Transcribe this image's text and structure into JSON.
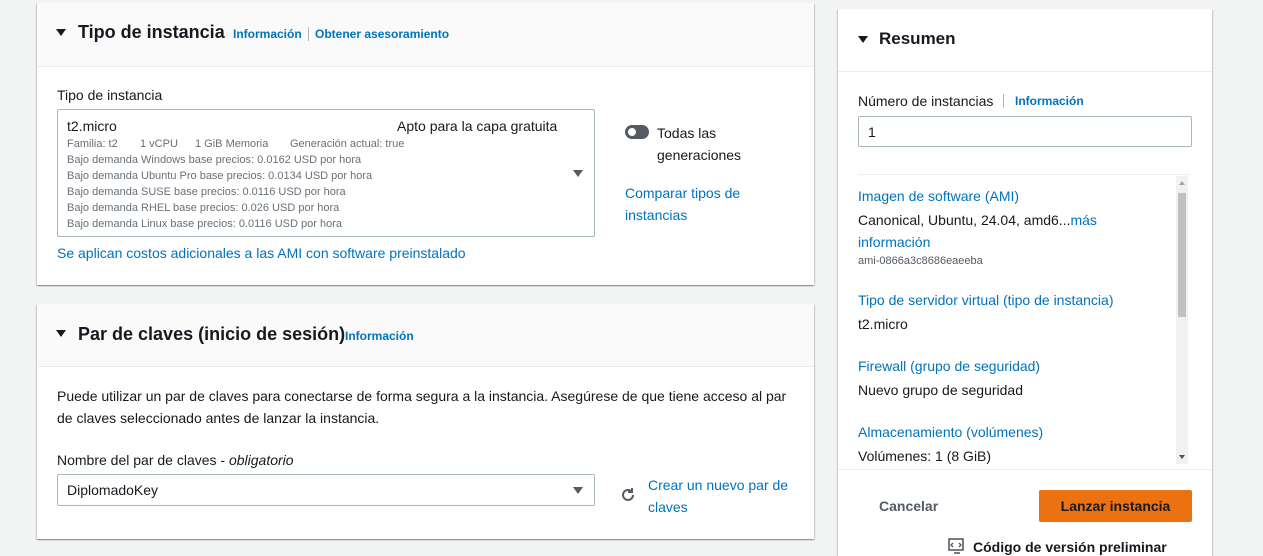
{
  "instance_type": {
    "title": "Tipo de instancia",
    "info_link": "Información",
    "advice_link": "Obtener asesoramiento",
    "field_label": "Tipo de instancia",
    "selected": {
      "name": "t2.micro",
      "free_tier": "Apto para la capa gratuita",
      "family": "Familia: t2",
      "vcpu": "1 vCPU",
      "memory": "1 GiB Memoria",
      "generation": "Generación actual: true",
      "prices": [
        "Bajo demanda Windows base precios: 0.0162 USD por hora",
        "Bajo demanda Ubuntu Pro base precios: 0.0134 USD por hora",
        "Bajo demanda SUSE base precios: 0.0116 USD por hora",
        "Bajo demanda RHEL base precios: 0.026 USD por hora",
        "Bajo demanda Linux base precios: 0.0116 USD por hora"
      ]
    },
    "toggle_label_1": "Todas las",
    "toggle_label_2": "generaciones",
    "compare_link_1": "Comparar tipos de",
    "compare_link_2": "instancias",
    "costs_note": "Se aplican costos adicionales a las AMI con software preinstalado"
  },
  "key_pair": {
    "title": "Par de claves (inicio de sesión)",
    "info_link": "Información",
    "desc_1": "Puede utilizar un par de claves para conectarse de forma segura a la instancia. Asegúrese de que tiene acceso al par",
    "desc_2": "de claves seleccionado antes de lanzar la instancia.",
    "field_label": "Nombre del par de claves - ",
    "field_required": "obligatorio",
    "selected": "DiplomadoKey",
    "create_link_1": "Crear un nuevo par de",
    "create_link_2": "claves"
  },
  "summary": {
    "title": "Resumen",
    "count_label": "Número de instancias",
    "info_link": "Información",
    "count_value": "1",
    "ami_link": "Imagen de software (AMI)",
    "ami_value": "Canonical, Ubuntu, 24.04, amd6...",
    "ami_more_1": "más",
    "ami_more_2": "información",
    "ami_id": "ami-0866a3c8686eaeeba",
    "server_link": "Tipo de servidor virtual (tipo de instancia)",
    "server_value": "t2.micro",
    "firewall_link": "Firewall (grupo de seguridad)",
    "firewall_value": "Nuevo grupo de seguridad",
    "storage_link": "Almacenamiento (volúmenes)",
    "storage_value": "Volúmenes: 1 (8 GiB)",
    "cancel": "Cancelar",
    "launch": "Lanzar instancia",
    "preview_code": "Código de versión preliminar"
  },
  "colors": {
    "accent_orange": "#ec7211",
    "link_blue": "#0073bb",
    "text_dark": "#16191f"
  }
}
